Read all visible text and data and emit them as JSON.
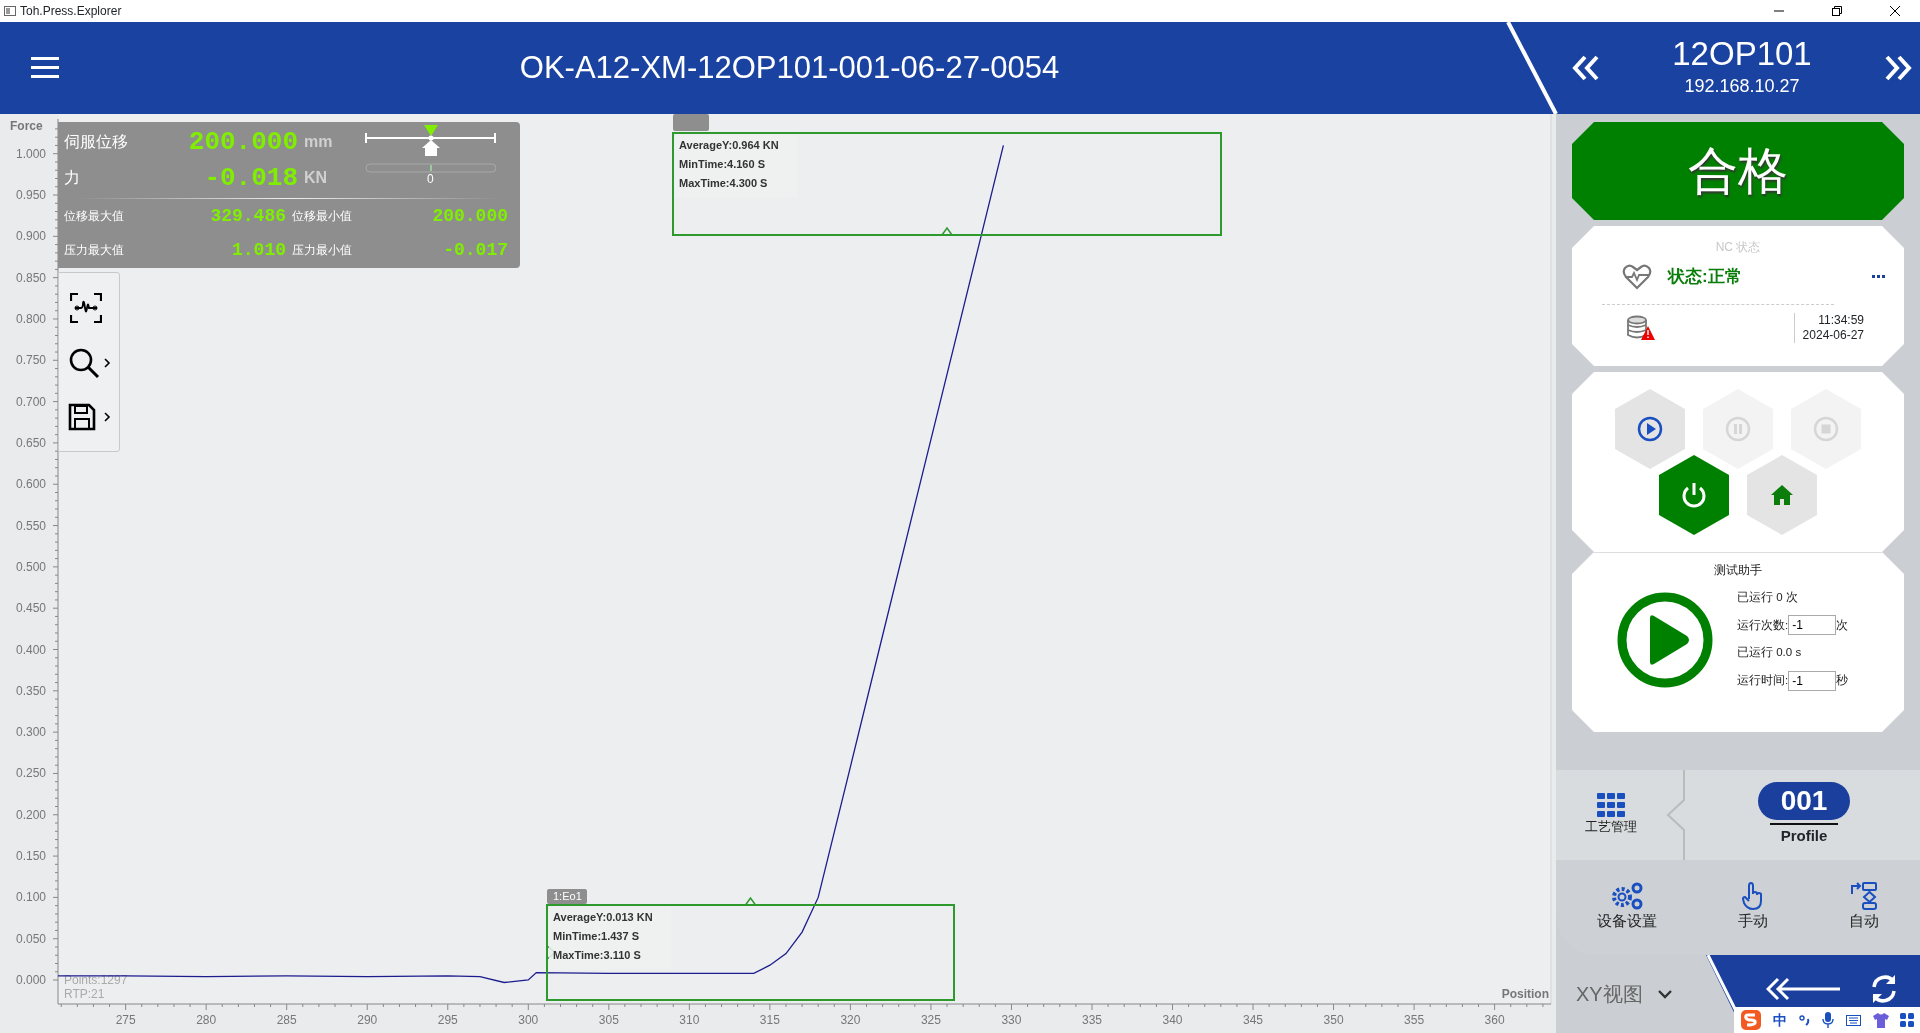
{
  "window": {
    "title": "Toh.Press.Explorer"
  },
  "header": {
    "title": "OK-A12-XM-12OP101-001-06-27-0054",
    "station": "12OP101",
    "ip": "192.168.10.27"
  },
  "readout": {
    "rows": [
      {
        "label": "伺服位移",
        "value": "200.000",
        "unit": "mm"
      },
      {
        "label": "力",
        "value": "-0.018",
        "unit": "KN"
      }
    ],
    "position_slider": {
      "level": 0.5
    },
    "force_gauge": {
      "reading": "0",
      "level": 0.5
    },
    "stats": [
      {
        "label": "位移最大值",
        "value": "329.486"
      },
      {
        "label": "位移最小值",
        "value": "200.000"
      },
      {
        "label": "压力最大值",
        "value": "1.010"
      },
      {
        "label": "压力最小值",
        "value": "-0.017"
      }
    ]
  },
  "chart": {
    "points_text": "Points:1297",
    "rtp_text": "RTP:21",
    "chart_data": {
      "type": "line",
      "xlabel": "Position",
      "ylabel": "Force",
      "x": [
        270.8,
        275,
        280,
        285,
        290,
        295,
        297,
        298.5,
        300,
        300.5,
        305,
        310,
        314,
        315,
        316,
        317,
        318,
        320,
        322,
        324,
        326,
        328,
        329.5
      ],
      "series": [
        {
          "color": "#1c1c8e",
          "values": [
            0.005,
            0.005,
            0.004,
            0.005,
            0.004,
            0.005,
            0.004,
            -0.003,
            0.0,
            0.009,
            0.008,
            0.008,
            0.008,
            0.018,
            0.032,
            0.058,
            0.1,
            0.258,
            0.417,
            0.575,
            0.733,
            0.891,
            1.01
          ]
        }
      ],
      "xlim": [
        270.8,
        363.5
      ],
      "ylim": [
        -0.029,
        1.042
      ],
      "xticks": [
        275,
        280,
        285,
        290,
        295,
        300,
        305,
        310,
        315,
        320,
        325,
        330,
        335,
        340,
        345,
        350,
        355,
        360
      ],
      "yticks": [
        {
          "value": 0,
          "label": "0.000"
        },
        {
          "value": 0.05,
          "label": "0.050"
        },
        {
          "value": 0.1,
          "label": "0.100"
        },
        {
          "value": 0.15,
          "label": "0.150"
        },
        {
          "value": 0.2,
          "label": "0.200"
        },
        {
          "value": 0.25,
          "label": "0.250"
        },
        {
          "value": 0.3,
          "label": "0.300"
        },
        {
          "value": 0.35,
          "label": "0.350"
        },
        {
          "value": 0.4,
          "label": "0.400"
        },
        {
          "value": 0.45,
          "label": "0.450"
        },
        {
          "value": 0.5,
          "label": "0.500"
        },
        {
          "value": 0.55,
          "label": "0.550"
        },
        {
          "value": 0.6,
          "label": "0.600"
        },
        {
          "value": 0.65,
          "label": "0.650"
        },
        {
          "value": 0.7,
          "label": "0.700"
        },
        {
          "value": 0.75,
          "label": "0.750"
        },
        {
          "value": 0.8,
          "label": "0.800"
        },
        {
          "value": 0.85,
          "label": "0.850"
        },
        {
          "value": 0.9,
          "label": "0.900"
        },
        {
          "value": 0.95,
          "label": "0.950"
        },
        {
          "value": 1,
          "label": "1.000"
        }
      ]
    },
    "windows": [
      {
        "lines": [
          "AverageY:0.964 KN",
          "MinTime:4.160 S",
          "MaxTime:4.300 S"
        ]
      },
      {
        "label": "1:Eo1",
        "lines": [
          "AverageY:0.013 KN",
          "MinTime:1.437 S",
          "MaxTime:3.110 S"
        ]
      }
    ]
  },
  "result": {
    "text": "合格",
    "passed": true
  },
  "nc_status": {
    "title": "NC 状态",
    "status": "状态:正常",
    "time": "11:34:59",
    "date": "2024-06-27"
  },
  "controls": [
    {
      "kind": "play",
      "disabled": false,
      "on": false
    },
    {
      "kind": "pause",
      "disabled": true,
      "on": false
    },
    {
      "kind": "stop",
      "disabled": true,
      "on": false
    },
    {
      "kind": "power",
      "disabled": false,
      "on": true
    },
    {
      "kind": "home",
      "disabled": false,
      "on": false
    }
  ],
  "test_assistant": {
    "title": "测试助手",
    "runs_done": "已运行 0 次",
    "count_label": "运行次数:",
    "count_value": "-1",
    "count_unit": "次",
    "time_done": "已运行 0.0 s",
    "time_label": "运行时间:",
    "time_value": "-1",
    "time_unit": "秒"
  },
  "profile": {
    "menu_label": "工艺管理",
    "number": "001",
    "name": "Profile"
  },
  "nav_buttons": [
    {
      "kind": "settings",
      "label": "设备设置"
    },
    {
      "kind": "manual",
      "label": "手动"
    },
    {
      "kind": "auto",
      "label": "自动"
    }
  ],
  "view_select": {
    "value": "XY视图"
  },
  "ime": {
    "mode": "中"
  }
}
